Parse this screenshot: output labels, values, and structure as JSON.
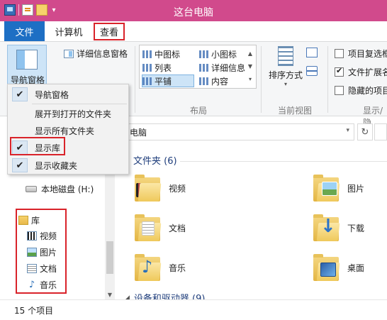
{
  "window": {
    "title": "这台电脑"
  },
  "tabs": {
    "file": "文件",
    "computer": "计算机",
    "view": "查看"
  },
  "ribbon": {
    "nav_pane_label": "导航窗格",
    "details_pane_label": "详细信息窗格",
    "layout_items": [
      "中图标",
      "小图标",
      "列表",
      "详细信息",
      "平铺",
      "内容"
    ],
    "layout_selected": "平铺",
    "sort_label": "排序方式",
    "checkboxes": [
      {
        "label": "项目复选框",
        "checked": false
      },
      {
        "label": "文件扩展名",
        "checked": true
      },
      {
        "label": "隐藏的项目",
        "checked": false
      }
    ],
    "group_labels": {
      "layout": "布局",
      "current_view": "当前视图",
      "show_hide": "显示/隐"
    }
  },
  "nav_menu": {
    "items": [
      {
        "label": "导航窗格",
        "checked": true
      },
      {
        "label": "展开到打开的文件夹",
        "checked": false
      },
      {
        "label": "显示所有文件夹",
        "checked": false
      },
      {
        "label": "显示库",
        "checked": true
      },
      {
        "label": "显示收藏夹",
        "checked": true
      }
    ]
  },
  "address": {
    "path": "电脑"
  },
  "navpane": {
    "drive": "本地磁盘 (H:)",
    "library": "库",
    "library_items": [
      "视频",
      "图片",
      "文档",
      "音乐"
    ]
  },
  "content": {
    "folders_header": "文件夹 (6)",
    "folders": [
      "视频",
      "图片",
      "文档",
      "下载",
      "音乐",
      "桌面"
    ],
    "devices_header": "设备和驱动器 (9)"
  },
  "status": {
    "item_count": "15 个项目"
  },
  "colors": {
    "title_bar": "#d14a8c",
    "file_tab": "#1e6fc4",
    "highlight_box": "#d9232a"
  }
}
